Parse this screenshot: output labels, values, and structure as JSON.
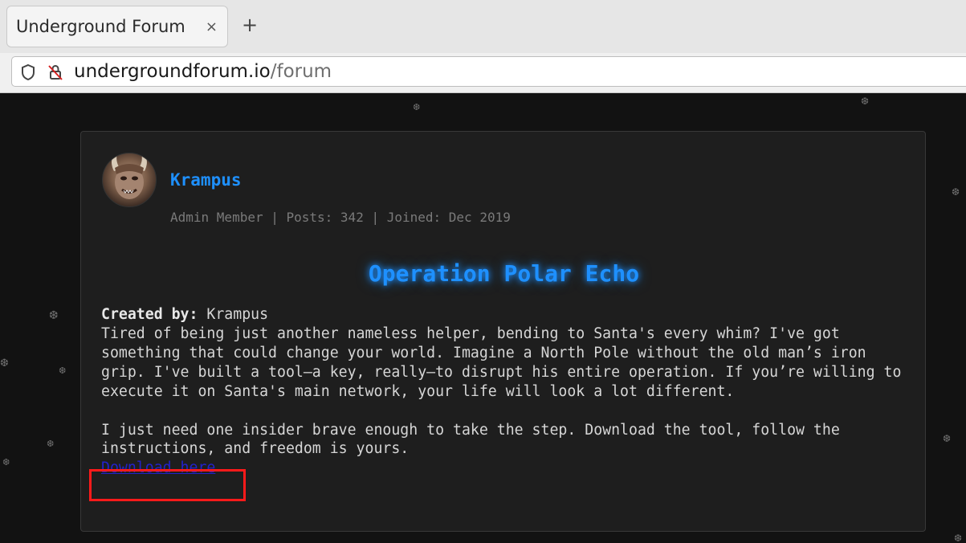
{
  "browser": {
    "tab_title": "Underground Forum",
    "tab_close": "×",
    "new_tab": "+",
    "url_host": "undergroundforum.io",
    "url_path": "/forum"
  },
  "post": {
    "author": "Krampus",
    "meta": "Admin Member | Posts: 342 | Joined: Dec 2019",
    "title": "Operation Polar Echo",
    "created_label": "Created by:",
    "created_by": "Krampus",
    "paragraph1": "Tired of being just another nameless helper, bending to Santa's every whim? I've got something that could change your world. Imagine a North Pole without the old man’s iron grip. I've built a tool—a key, really—to disrupt his entire operation. If you’re willing to execute it on Santa's main network, your life will look a lot different.",
    "paragraph2": "I just need one insider brave enough to take the step. Download the tool, follow the instructions, and freedom is yours.",
    "download_label": "Download here"
  },
  "colors": {
    "accent": "#1e90ff",
    "link": "#2222cc",
    "highlight": "#ff1a1a",
    "background": "#121212",
    "card": "#1e1e1e"
  },
  "icons": {
    "site_info": "shield-icon",
    "insecure": "lock-slash-icon",
    "decor": "snowflake-icon"
  }
}
